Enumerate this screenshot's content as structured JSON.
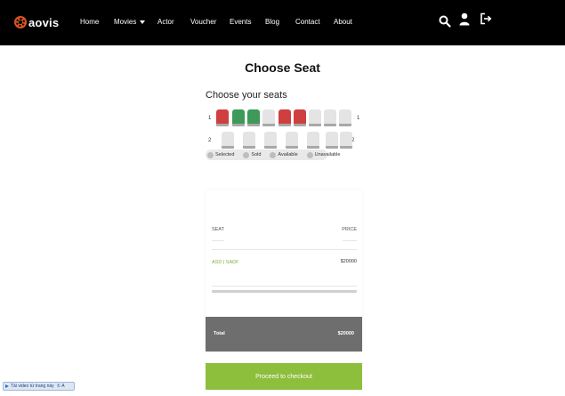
{
  "brand": {
    "logo_text": "aovis",
    "logo_color": "#d9541e"
  },
  "nav": {
    "items": [
      {
        "label": "Home"
      },
      {
        "label": "Movies",
        "has_dropdown": true
      },
      {
        "label": "Actor"
      },
      {
        "label": "Voucher"
      },
      {
        "label": "Events"
      },
      {
        "label": "Blog"
      },
      {
        "label": "Contact"
      },
      {
        "label": "About"
      }
    ],
    "icons": [
      "search-icon",
      "user-icon",
      "logout-icon"
    ]
  },
  "page": {
    "title": "Choose Seat",
    "subtitle": "Choose your seats"
  },
  "seating": {
    "rows": [
      {
        "label": "1",
        "seats": [
          "sold",
          "selected",
          "selected",
          "available",
          "sold",
          "sold",
          "available",
          "available",
          "available"
        ]
      },
      {
        "label": "2",
        "seats": [
          "available",
          "available",
          "available",
          "available",
          "available",
          "available",
          "available"
        ]
      }
    ],
    "colors": {
      "sold": "#cf3f3f",
      "selected": "#3d9a58",
      "available": "#e4e4e4"
    }
  },
  "legend": [
    {
      "label": "Selected"
    },
    {
      "label": "Sold"
    },
    {
      "label": "Available"
    },
    {
      "label": "Unavailable"
    }
  ],
  "summary": {
    "seat_header": "SEAT",
    "price_header": "PRICE",
    "seat_value": "ASD | SADF",
    "price_value": "$20000",
    "total_label": "Total",
    "total_value": "$20000"
  },
  "checkout": {
    "label": "Proceed to checkout",
    "color": "#8dbe3c"
  },
  "browser_badge": {
    "label": "Tải video từ trang này",
    "suffix": "① A"
  }
}
